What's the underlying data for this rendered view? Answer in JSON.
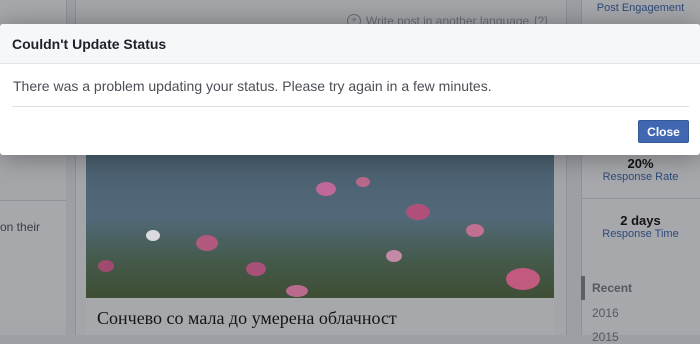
{
  "background": {
    "left_text": "on their",
    "write_post_label": "Write post in another language",
    "write_post_extra": "[?]",
    "photo_caption": "Сончево со мала до умерена облачност",
    "right": {
      "post_engagement": "Post Engagement",
      "response_rate_value": "20%",
      "response_rate_label": "Response Rate",
      "response_time_value": "2 days",
      "response_time_label": "Response Time",
      "timeline": [
        "Recent",
        "2016",
        "2015"
      ]
    }
  },
  "dialog": {
    "title": "Couldn't Update Status",
    "message": "There was a problem updating your status. Please try again in a few minutes.",
    "close_label": "Close"
  },
  "colors": {
    "button": "#4267b2",
    "overlay": "#9c9fa4"
  }
}
